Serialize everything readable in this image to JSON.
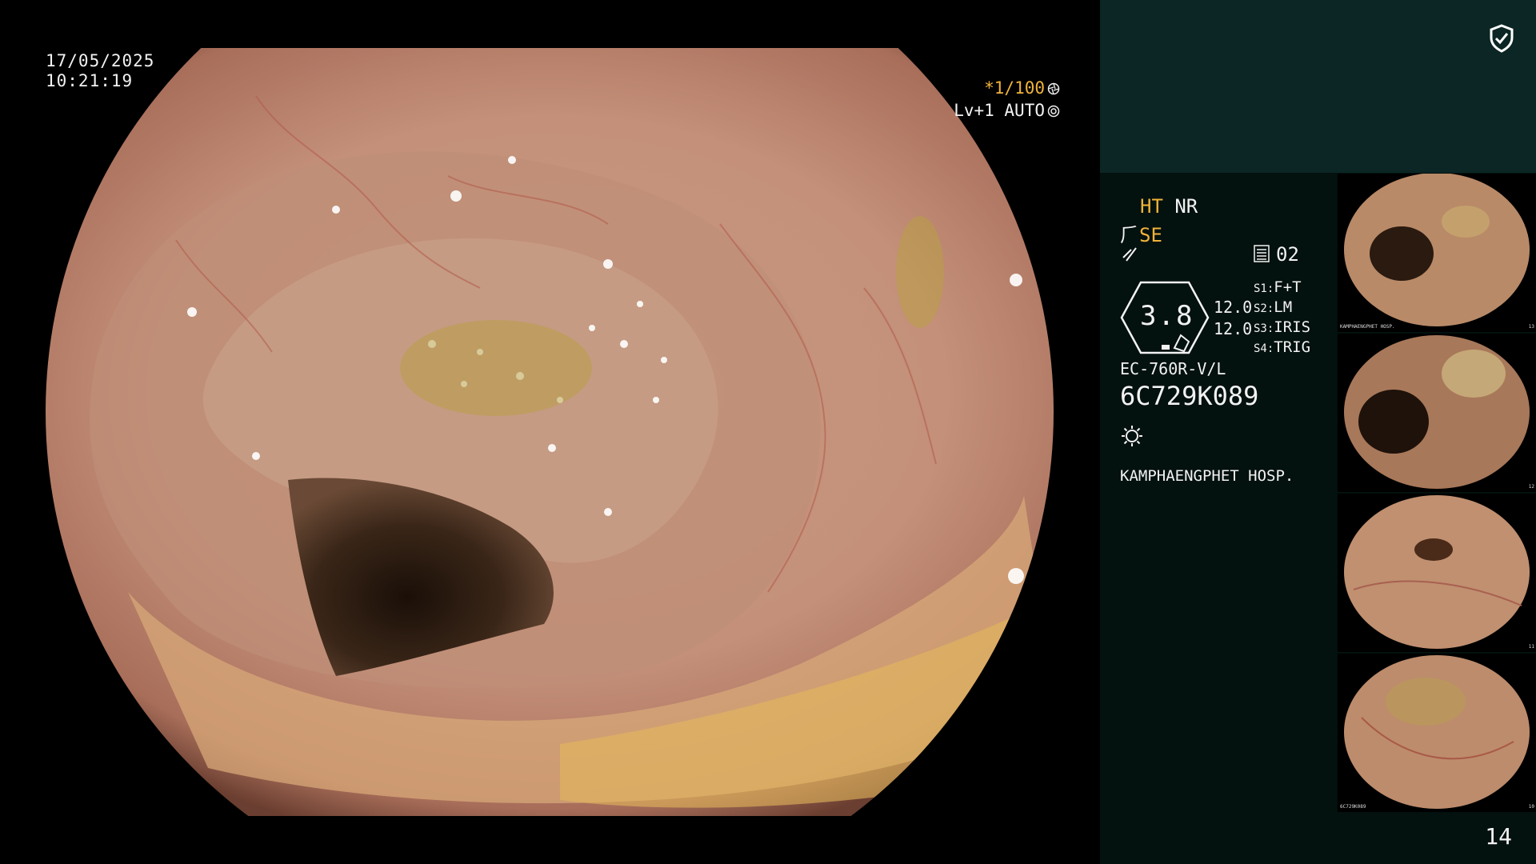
{
  "view": {
    "date": "17/05/2025",
    "time": "10:21:19",
    "shutter": "*1/100",
    "iris_level": "Lv+1 AUTO"
  },
  "panel": {
    "mode_ht": "HT",
    "mode_nr": "NR",
    "se_label": "SE",
    "counter": "02",
    "zoom_value": "3.8",
    "v_val_1": "12.0",
    "v_val_2": "12.0",
    "switches": [
      {
        "key": "S1:",
        "value": "F+T"
      },
      {
        "key": "S2:",
        "value": "LM"
      },
      {
        "key": "S3:",
        "value": "IRIS"
      },
      {
        "key": "S4:",
        "value": "TRIG"
      }
    ],
    "scope_model": "EC-760R-V/L",
    "serial": "6C729K089",
    "hospital": "KAMPHAENGPHET HOSP.",
    "thumbnail_caption": "KAMPHAENGPHET HOSP.",
    "thumbnail_serial": "6C729K089",
    "thumbnail_numbers": [
      "13",
      "12",
      "11",
      "10"
    ]
  },
  "page_number": "14",
  "icons": [
    "shield-check-icon",
    "shutter-icon",
    "iris-icon",
    "pen-icon",
    "bar-icon",
    "light-icon"
  ],
  "colors": {
    "accent": "#f0b33a",
    "panel_top": "#0b2624",
    "panel": "#03110f"
  }
}
